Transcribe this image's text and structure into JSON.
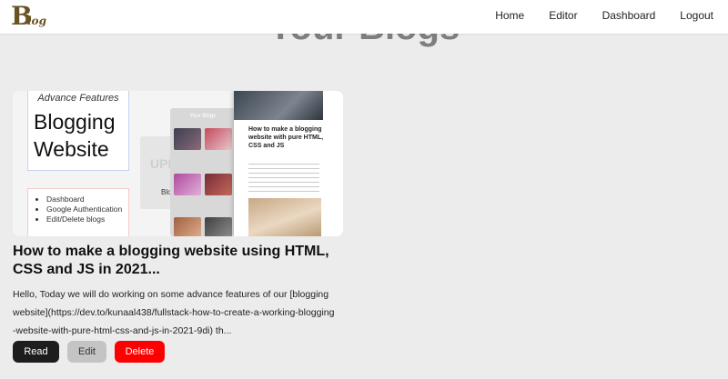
{
  "navbar": {
    "logo": {
      "letter": "B",
      "text": "log"
    },
    "links": [
      "Home",
      "Editor",
      "Dashboard",
      "Logout"
    ]
  },
  "page_title": "Your Blogs",
  "blog_card": {
    "thumbnail": {
      "feature_subtitle": "Advance Features",
      "feature_title_line1": "Blogging",
      "feature_title_line2": "Website",
      "features": [
        "Dashboard",
        "Google Authentication",
        "Edit/Delete blogs"
      ],
      "mock_heading": "Your Blogs",
      "mock_post_title": "How to make a blogging website with pure HTML, CSS and JS",
      "mock_bg_text": "UPL",
      "mock_bg_sub": "Blo"
    },
    "title": "How to make a blogging website using HTML, CSS and JS in 2021...",
    "description": "Hello, Today we will do working on some advance features of our [blogging website](https://dev.to/kunaal438/fullstack-how-to-create-a-working-blogging-website-with-pure-html-css-and-js-in-2021-9di) th...",
    "buttons": {
      "read": "Read",
      "edit": "Edit",
      "delete": "Delete"
    }
  },
  "colors": {
    "logo": "#6a5222",
    "delete_button": "#ff0000",
    "read_button": "#1d1d1d",
    "edit_button": "#c4c4c4",
    "page_background": "#ececec"
  }
}
